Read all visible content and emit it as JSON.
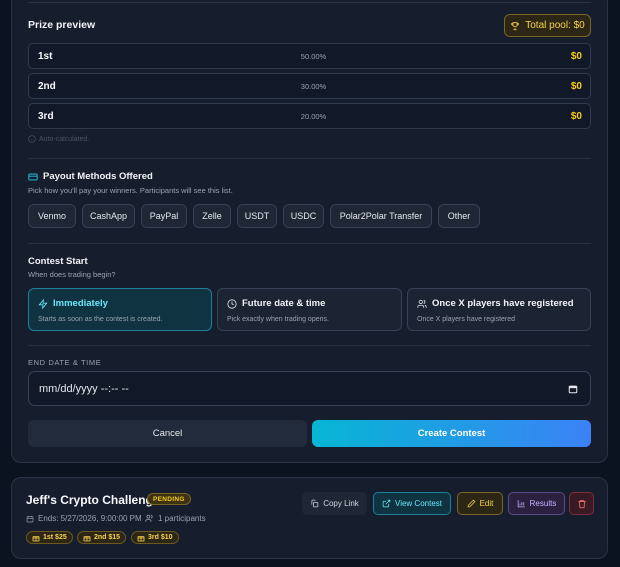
{
  "prize_preview": {
    "title": "Prize preview",
    "total_pool": "Total pool: $0",
    "rows": [
      {
        "place": "1st",
        "percent": "50.00%",
        "amount": "$0"
      },
      {
        "place": "2nd",
        "percent": "30.00%",
        "amount": "$0"
      },
      {
        "place": "3rd",
        "percent": "20.00%",
        "amount": "$0"
      }
    ],
    "auto_note": "Auto-calculated."
  },
  "payout_methods": {
    "title": "Payout Methods Offered",
    "subtitle": "Pick how you'll pay your winners. Participants will see this list.",
    "options": [
      "Venmo",
      "CashApp",
      "PayPal",
      "Zelle",
      "USDT",
      "USDC",
      "Polar2Polar Transfer",
      "Other"
    ]
  },
  "contest_start": {
    "title": "Contest Start",
    "subtitle": "When does trading begin?",
    "options": [
      {
        "title": "Immediately",
        "desc": "Starts as soon as the contest is created.",
        "selected": true
      },
      {
        "title": "Future date & time",
        "desc": "Pick exactly when trading opens.",
        "selected": false
      },
      {
        "title": "Once X players have registered",
        "desc": "Once X players have registered",
        "selected": false
      }
    ]
  },
  "end_date": {
    "label": "END DATE & TIME",
    "value": "mm/dd/yyyy --:-- --"
  },
  "actions": {
    "cancel": "Cancel",
    "create": "Create Contest"
  },
  "contest": {
    "name": "Jeff's Crypto Challenge",
    "status": "PENDING",
    "ends": "Ends: 5/27/2026, 9:00:00 PM",
    "participants": "1 participants",
    "prizes": [
      "1st $25",
      "2nd $15",
      "3rd $10"
    ],
    "buttons": {
      "copy": "Copy Link",
      "view": "View Contest",
      "edit": "Edit",
      "results": "Results"
    }
  },
  "colors": {
    "accent": "#06b6d4",
    "gold": "#facc15",
    "danger": "#f87171"
  }
}
